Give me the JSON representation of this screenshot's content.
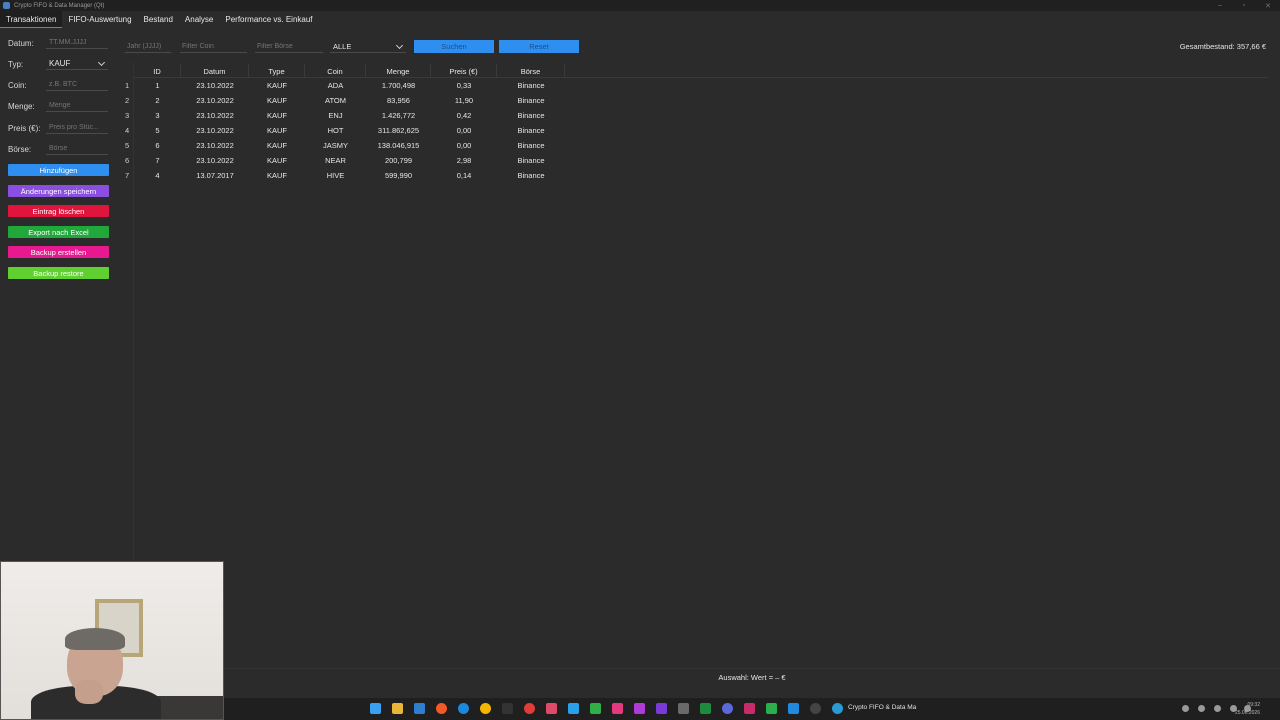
{
  "window": {
    "title": "Crypto FIFO & Data Manager (Qt)"
  },
  "tabs": [
    "Transaktionen",
    "FIFO-Auswertung",
    "Bestand",
    "Analyse",
    "Performance vs. Einkauf"
  ],
  "form": {
    "datum_label": "Datum:",
    "datum_placeholder": "TT.MM.JJJJ",
    "typ_label": "Typ:",
    "typ_value": "KAUF",
    "coin_label": "Coin:",
    "coin_placeholder": "z.B. BTC",
    "menge_label": "Menge:",
    "menge_placeholder": "Menge",
    "preis_label": "Preis (€):",
    "preis_placeholder": "Preis pro Stüc...",
    "boerse_label": "Börse:",
    "boerse_placeholder": "Börse"
  },
  "buttons": {
    "add": "Hinzufügen",
    "save": "Änderungen speichern",
    "delete": "Eintrag löschen",
    "export": "Export nach Excel",
    "backup": "Backup erstellen",
    "restore": "Backup restore"
  },
  "filters": {
    "jahr_placeholder": "Jahr (JJJJ)",
    "coin_placeholder": "Filter Coin",
    "boerse_placeholder": "Filter Börse",
    "select_value": "ALLE",
    "search_label": "Suchen",
    "reset_label": "Reset"
  },
  "total": "Gesamtbestand: 357,66 €",
  "table": {
    "headers": [
      "ID",
      "Datum",
      "Type",
      "Coin",
      "Menge",
      "Preis (€)",
      "Börse"
    ],
    "rows": [
      {
        "rn": "1",
        "id": "1",
        "datum": "23.10.2022",
        "type": "KAUF",
        "coin": "ADA",
        "menge": "1.700,498",
        "preis": "0,33",
        "boerse": "Binance"
      },
      {
        "rn": "2",
        "id": "2",
        "datum": "23.10.2022",
        "type": "KAUF",
        "coin": "ATOM",
        "menge": "83,956",
        "preis": "11,90",
        "boerse": "Binance"
      },
      {
        "rn": "3",
        "id": "3",
        "datum": "23.10.2022",
        "type": "KAUF",
        "coin": "ENJ",
        "menge": "1.426,772",
        "preis": "0,42",
        "boerse": "Binance"
      },
      {
        "rn": "4",
        "id": "5",
        "datum": "23.10.2022",
        "type": "KAUF",
        "coin": "HOT",
        "menge": "311.862,625",
        "preis": "0,00",
        "boerse": "Binance"
      },
      {
        "rn": "5",
        "id": "6",
        "datum": "23.10.2022",
        "type": "KAUF",
        "coin": "JASMY",
        "menge": "138.046,915",
        "preis": "0,00",
        "boerse": "Binance"
      },
      {
        "rn": "6",
        "id": "7",
        "datum": "23.10.2022",
        "type": "KAUF",
        "coin": "NEAR",
        "menge": "200,799",
        "preis": "2,98",
        "boerse": "Binance"
      },
      {
        "rn": "7",
        "id": "4",
        "datum": "13.07.2017",
        "type": "KAUF",
        "coin": "HIVE",
        "menge": "599,990",
        "preis": "0,14",
        "boerse": "Binance"
      }
    ]
  },
  "status": "Auswahl: Wert = – €",
  "taskbar": {
    "app_label": "Crypto FIFO & Data Ma",
    "time": "09:32",
    "date": "25.06.2026"
  },
  "colors": {
    "blue": "#2f8ff0",
    "purple": "#8a4ee0",
    "red": "#e0143c",
    "green": "#20a83a",
    "pink": "#e8188e",
    "lime": "#5fd030"
  }
}
